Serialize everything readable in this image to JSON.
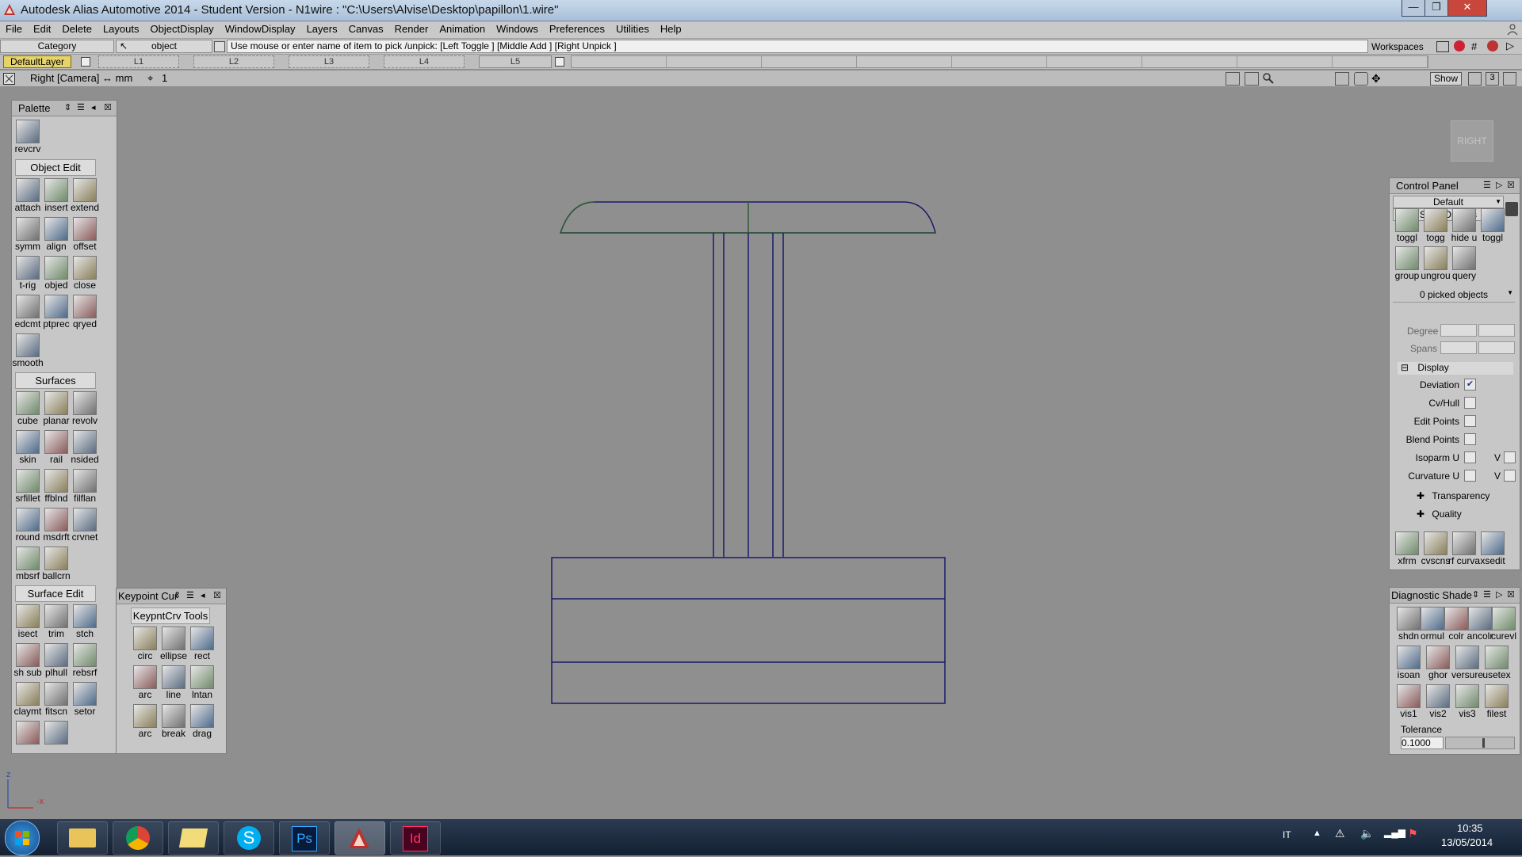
{
  "window": {
    "title": "Autodesk Alias Automotive 2014   - Student Version   - N1wire : \"C:\\Users\\Alvise\\Desktop\\papillon\\1.wire\"",
    "minimize": "—",
    "maximize": "❐",
    "close": "✕"
  },
  "menu": [
    "File",
    "Edit",
    "Delete",
    "Layouts",
    "ObjectDisplay",
    "WindowDisplay",
    "Layers",
    "Canvas",
    "Render",
    "Animation",
    "Windows",
    "Preferences",
    "Utilities",
    "Help"
  ],
  "prompt": {
    "category_label": "Category",
    "object_label": "object",
    "message": "Use mouse or enter name of item to pick /unpick: [Left Toggle ] [Middle Add ] [Right Unpick ]",
    "workspaces_label": "Workspaces"
  },
  "layers": {
    "default_layer": "DefaultLayer",
    "slots": [
      "L1",
      "L2",
      "L3",
      "L4",
      "L5"
    ]
  },
  "view": {
    "title": "Right [Camera]  ↔ mm",
    "grid_value": "1",
    "show_label": "Show",
    "view_cube_label": "RIGHT"
  },
  "palette": {
    "title": "Palette",
    "top_tool": "revcrv",
    "sections": [
      {
        "name": "Object Edit",
        "tools": [
          "attach",
          "insert",
          "extend",
          "symm",
          "align",
          "offset",
          "t-rig",
          "objed",
          "close",
          "edcmt",
          "ptprec",
          "qryed",
          "smooth"
        ]
      },
      {
        "name": "Surfaces",
        "tools": [
          "cube",
          "planar",
          "revolv",
          "skin",
          "rail",
          "nsided",
          "srfillet",
          "ffblnd",
          "filflan",
          "round",
          "msdrft",
          "crvnet",
          "mbsrf",
          "ballcrn"
        ]
      },
      {
        "name": "Surface Edit",
        "tools": [
          "isect",
          "trim",
          "stch",
          "sh sub",
          "plhull",
          "rebsrf",
          "claymt",
          "fitscn",
          "setor",
          "",
          ""
        ]
      }
    ]
  },
  "keypoint": {
    "title": "Keypoint Cur",
    "section": "KeypntCrv Tools",
    "tools": [
      "circ",
      "ellipse",
      "rect",
      "arc",
      "line",
      "lntan",
      "arc",
      "break",
      "drag"
    ]
  },
  "control_panel": {
    "title": "Control Panel",
    "preset": "Default",
    "shelf_options": "Shelf Options",
    "shelf_tools_row1": [
      "toggl",
      "togg",
      "hide u",
      "toggl"
    ],
    "shelf_tools_row2": [
      "group",
      "ungrou",
      "query"
    ],
    "picked": "0 picked objects",
    "degree_label": "Degree",
    "spans_label": "Spans",
    "display_label": "Display",
    "options": [
      {
        "label": "Deviation",
        "checked": true
      },
      {
        "label": "Cv/Hull",
        "checked": false
      },
      {
        "label": "Edit Points",
        "checked": false
      },
      {
        "label": "Blend Points",
        "checked": false
      },
      {
        "label": "Isoparm U",
        "checked": false,
        "v": "V"
      },
      {
        "label": "Curvature U",
        "checked": false,
        "v": "V"
      }
    ],
    "transparency": "Transparency",
    "quality": "Quality",
    "bottom_tools": [
      "xfrm",
      "cvscns",
      "rf curva",
      "xsedit"
    ]
  },
  "diagnostic": {
    "title": "Diagnostic Shade",
    "tools_row1": [
      "shdn",
      "ormul",
      "colr",
      "ancolr",
      "curevl"
    ],
    "tools_row2": [
      "isoan",
      "ghor",
      "versurevl",
      "usetex"
    ],
    "tools_row3": [
      "vis1",
      "vis2",
      "vis3",
      "filest"
    ],
    "tolerance_label": "Tolerance",
    "tolerance_value": "0.1000"
  },
  "axis": {
    "z": "z",
    "x": "-x"
  },
  "taskbar": {
    "lang": "IT",
    "time": "10:35",
    "date": "13/05/2014",
    "apps": [
      "explorer",
      "chrome",
      "folder",
      "skype",
      "photoshop",
      "alias",
      "indesign"
    ]
  },
  "colors": {
    "viewport_bg": "#8f8f8f",
    "wire_blue": "#1a1a6e",
    "wire_green": "#2f5a35",
    "taskbar_bg": "#1c2a40"
  }
}
